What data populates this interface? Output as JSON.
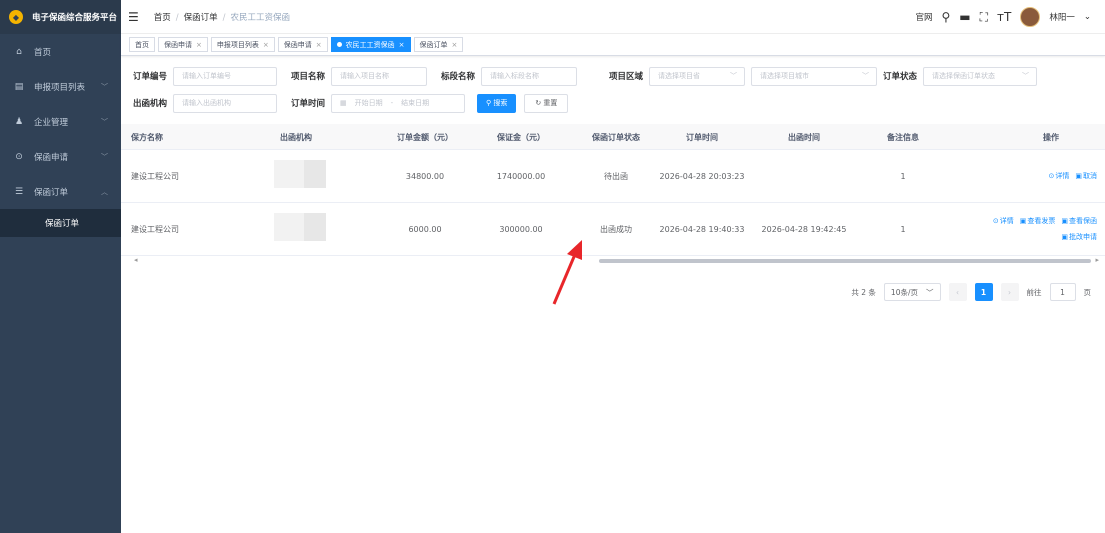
{
  "app": {
    "title": "电子保函综合服务平台",
    "logo_glyph": "◆"
  },
  "sidebar": {
    "items": [
      {
        "icon": "home-icon",
        "glyph": "⌂",
        "label": "首页"
      },
      {
        "icon": "list-icon",
        "glyph": "▤",
        "label": "申报项目列表",
        "arrow": "﹀"
      },
      {
        "icon": "users-icon",
        "glyph": "♟",
        "label": "企业管理",
        "arrow": "﹀"
      },
      {
        "icon": "pin-icon",
        "glyph": "⊙",
        "label": "保函申请",
        "arrow": "﹀"
      },
      {
        "icon": "order-icon",
        "glyph": "☰",
        "label": "保函订单",
        "arrow": "︿"
      }
    ],
    "subitems": [
      {
        "label": "保函订单"
      }
    ]
  },
  "header": {
    "breadcrumb": [
      "首页",
      "保函订单",
      "农民工工资保函"
    ],
    "breadcrumb_sep": "/",
    "official_link": "官网",
    "username": "林阳一",
    "user_caret": "⌄",
    "icons": {
      "search": "⚲",
      "message": "▬",
      "fullscreen": "⛶",
      "fontsize": "тT"
    },
    "hamburger": "☰"
  },
  "tags": [
    {
      "label": "首页",
      "closable": false
    },
    {
      "label": "保函申请",
      "closable": true
    },
    {
      "label": "申报项目列表",
      "closable": true
    },
    {
      "label": "保函申请",
      "closable": true
    },
    {
      "label": "农民工工资保函",
      "closable": true,
      "active": true
    },
    {
      "label": "保函订单",
      "closable": true
    }
  ],
  "tag_close": "×",
  "search": {
    "order_no": {
      "label": "订单编号",
      "placeholder": "请输入订单编号"
    },
    "project_name": {
      "label": "项目名称",
      "placeholder": "请输入项目名称"
    },
    "section_name": {
      "label": "标段名称",
      "placeholder": "请输入标段名称"
    },
    "region": {
      "label": "项目区域",
      "province_placeholder": "请选择项目省",
      "city_placeholder": "请选择项目城市"
    },
    "status": {
      "label": "订单状态",
      "placeholder": "请选择保函订单状态"
    },
    "issuer": {
      "label": "出函机构",
      "placeholder": "请输入出函机构"
    },
    "order_time": {
      "label": "订单时间",
      "start_placeholder": "开始日期",
      "range_sep": "-",
      "end_placeholder": "结束日期"
    },
    "search_button": "搜索",
    "reset_button": "重置",
    "dropdown_glyph": "﹀",
    "calendar_glyph": "▦",
    "search_glyph": "⚲",
    "reset_glyph": "↻"
  },
  "table": {
    "columns": [
      "保方名称",
      "出函机构",
      "订单金额（元）",
      "保证金（元）",
      "保函订单状态",
      "订单时间",
      "出函时间",
      "备注信息",
      "操作"
    ],
    "rows": [
      {
        "name": "建设工程公司",
        "amount": "34800.00",
        "deposit": "1740000.00",
        "status": "待出函",
        "order_time": "2026-04-28 20:03:23",
        "issue_time": "",
        "remark": "1",
        "ops": [
          [
            "详情",
            "取消"
          ]
        ]
      },
      {
        "name": "建设工程公司",
        "amount": "6000.00",
        "deposit": "300000.00",
        "status": "出函成功",
        "order_time": "2026-04-28 19:40:33",
        "issue_time": "2026-04-28 19:42:45",
        "remark": "1",
        "ops": [
          [
            "详情",
            "查看发票",
            "查看保函"
          ],
          [
            "批改申请"
          ]
        ]
      }
    ],
    "scroll_left": "◂",
    "scroll_right": "▸"
  },
  "pagination": {
    "total_text": "共 2 条",
    "page_size": "10条/页",
    "prev": "‹",
    "current_page": "1",
    "next": "›",
    "goto_label": "前往",
    "goto_value": "1",
    "page_unit": "页"
  },
  "colors": {
    "primary": "#1890ff",
    "sidebar": "#304156",
    "annotation": "#e8262a"
  }
}
